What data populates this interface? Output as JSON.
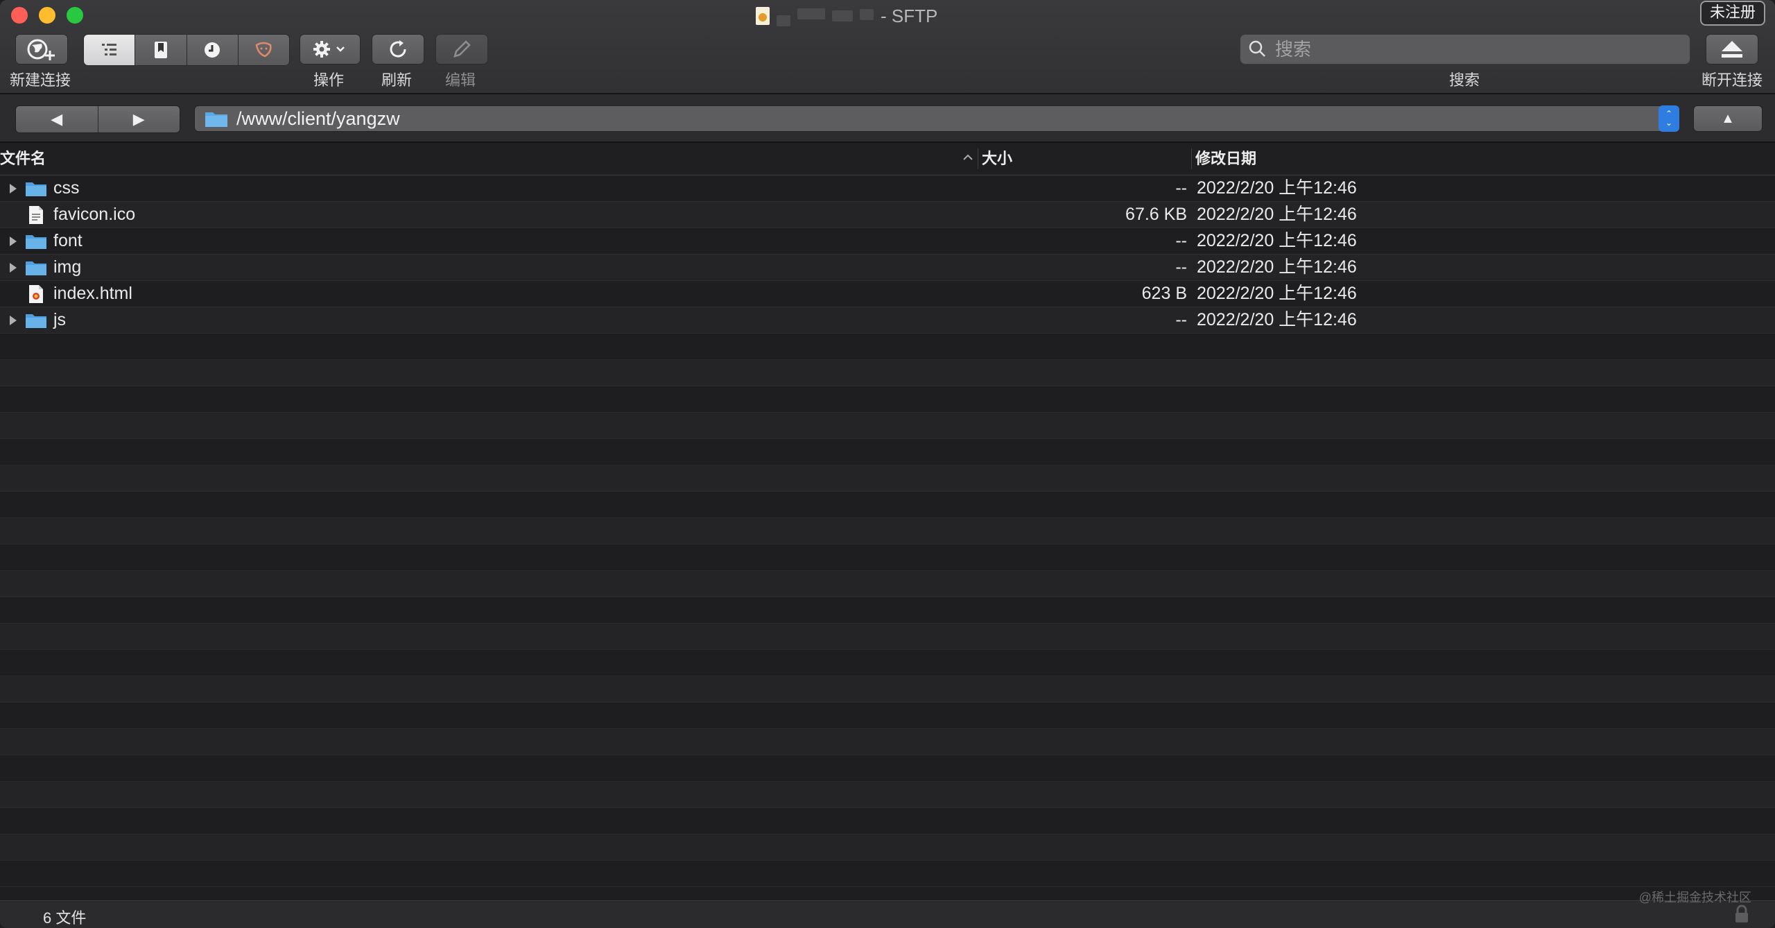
{
  "window": {
    "title": "- SFTP",
    "register_badge": "未注册"
  },
  "toolbar": {
    "new_connection": "新建连接",
    "actions": "操作",
    "refresh": "刷新",
    "edit": "编辑",
    "search_label": "搜索",
    "search_placeholder": "搜索",
    "disconnect": "断开连接"
  },
  "pathbar": {
    "back": "◀",
    "forward": "▶",
    "path": "/www/client/yangzw",
    "up": "▲"
  },
  "columns": {
    "name": "文件名",
    "size": "大小",
    "modified": "修改日期"
  },
  "files": [
    {
      "name": "css",
      "size": "--",
      "modified": "2022/2/20 上午12:46",
      "kind": "folder"
    },
    {
      "name": "favicon.ico",
      "size": "67.6 KB",
      "modified": "2022/2/20 上午12:46",
      "kind": "file-ico"
    },
    {
      "name": "font",
      "size": "--",
      "modified": "2022/2/20 上午12:46",
      "kind": "folder"
    },
    {
      "name": "img",
      "size": "--",
      "modified": "2022/2/20 上午12:46",
      "kind": "folder"
    },
    {
      "name": "index.html",
      "size": "623 B",
      "modified": "2022/2/20 上午12:46",
      "kind": "file-html"
    },
    {
      "name": "js",
      "size": "--",
      "modified": "2022/2/20 上午12:46",
      "kind": "folder"
    }
  ],
  "status": {
    "count": "6 文件"
  },
  "watermark": "@稀土掘金技术社区",
  "colors": {
    "accent": "#2f7de1",
    "folder": "#5aa9e6",
    "close": "#ff5f57",
    "minimize": "#febc2e",
    "maximize": "#28c840"
  }
}
